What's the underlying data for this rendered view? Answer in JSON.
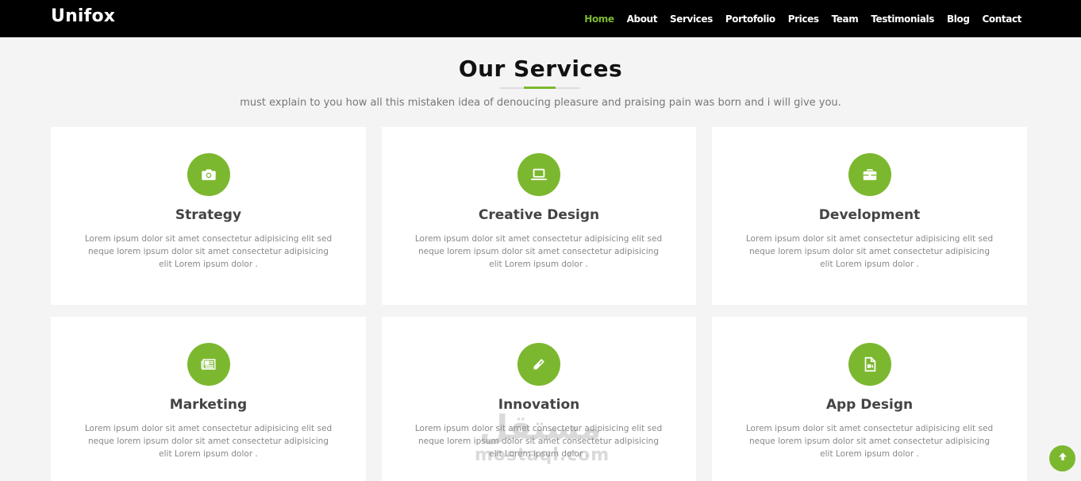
{
  "header": {
    "brand": "Unifox",
    "nav": [
      {
        "label": "Home",
        "active": true
      },
      {
        "label": "About"
      },
      {
        "label": "Services"
      },
      {
        "label": "Portofolio"
      },
      {
        "label": "Prices"
      },
      {
        "label": "Team"
      },
      {
        "label": "Testimonials"
      },
      {
        "label": "Blog"
      },
      {
        "label": "Contact"
      }
    ]
  },
  "section": {
    "title": "Our Services",
    "subtitle": "must explain to you how all this mistaken idea of denoucing pleasure and praising pain was born and i will give you."
  },
  "services": [
    {
      "icon": "camera-icon",
      "title": "Strategy",
      "text": "Lorem ipsum dolor sit amet consectetur adipisicing elit sed neque lorem ipsum dolor sit amet consectetur adipisicing elit Lorem ipsum dolor ."
    },
    {
      "icon": "laptop-icon",
      "title": "Creative Design",
      "text": "Lorem ipsum dolor sit amet consectetur adipisicing elit sed neque lorem ipsum dolor sit amet consectetur adipisicing elit Lorem ipsum dolor ."
    },
    {
      "icon": "briefcase-icon",
      "title": "Development",
      "text": "Lorem ipsum dolor sit amet consectetur adipisicing elit sed neque lorem ipsum dolor sit amet consectetur adipisicing elit Lorem ipsum dolor ."
    },
    {
      "icon": "newspaper-icon",
      "title": "Marketing",
      "text": "Lorem ipsum dolor sit amet consectetur adipisicing elit sed neque lorem ipsum dolor sit amet consectetur adipisicing elit Lorem ipsum dolor ."
    },
    {
      "icon": "pencil-icon",
      "title": "Innovation",
      "text": "Lorem ipsum dolor sit amet consectetur adipisicing elit sed neque lorem ipsum dolor sit amet consectetur adipisicing elit Lorem ipsum dolor ."
    },
    {
      "icon": "video-file-icon",
      "title": "App Design",
      "text": "Lorem ipsum dolor sit amet consectetur adipisicing elit sed neque lorem ipsum dolor sit amet consectetur adipisicing elit Lorem ipsum dolor ."
    }
  ],
  "watermark": {
    "arabic": "مستقل",
    "latin": "mostaql.com"
  },
  "scroll_top_icon": "arrow-up-icon",
  "colors": {
    "accent": "#7cb82f",
    "navbar": "#000000",
    "background": "#f4f4f4"
  }
}
